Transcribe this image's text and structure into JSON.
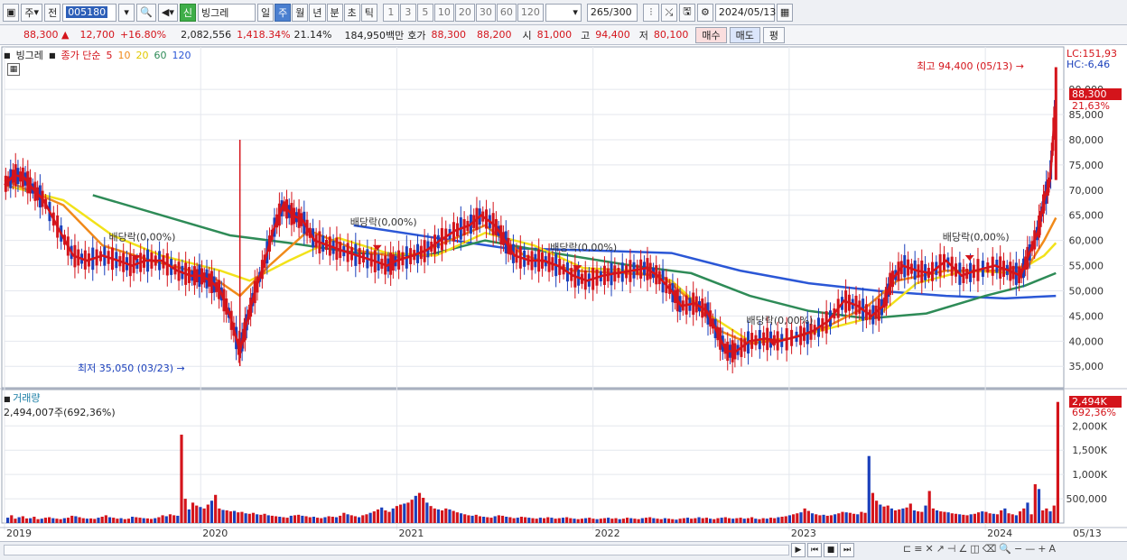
{
  "toolbar": {
    "type_label": "주",
    "prev_label": "전",
    "stock_code": "005180",
    "new_badge": "신",
    "stock_name": "빙그레",
    "periods": [
      "일",
      "주",
      "월",
      "년",
      "분",
      "초",
      "틱"
    ],
    "active_period": "주",
    "intervals": [
      "1",
      "3",
      "5",
      "10",
      "20",
      "30",
      "60",
      "120"
    ],
    "count": "265",
    "count_total": "/300",
    "date": "2024/05/13"
  },
  "infobar": {
    "price": "88,300 ▲",
    "change": "12,700",
    "change_pct": "+16.80%",
    "volume": "2,082,556",
    "volume_pct": "1,418.34%",
    "turnover": "21.14%",
    "amount": "184,950백만",
    "quote_label": "호가",
    "ask": "88,300",
    "bid": "88,200",
    "open_label": "시",
    "open": "81,000",
    "high_label": "고",
    "high": "94,400",
    "low_label": "저",
    "low": "80,100",
    "buy_label": "매수",
    "sell_label": "매도",
    "avg_label": "평"
  },
  "legend": {
    "name": "빙그레",
    "price_label": "종가 단순",
    "ma5": "5",
    "ma10": "10",
    "ma20": "20",
    "ma60": "60",
    "ma120": "120",
    "colors": {
      "ma5": "#d4141b",
      "ma10": "#f08a1a",
      "ma20": "#f2e21a",
      "ma60": "#2e8b57",
      "ma120": "#2b57d6"
    }
  },
  "annotations": {
    "lc": "LC:151,93",
    "hc": "HC:-6,46",
    "high_marker": "최고 94,400 (05/13)",
    "low_marker": "최저 35,050 (03/23)",
    "current_price": "88,300",
    "current_pct": "21,63%",
    "dividend": "배당락(0,00%)",
    "vol_current": "2,494K",
    "vol_pct": "692,36%"
  },
  "volume_panel": {
    "title": "거래량",
    "info": "2,494,007주(692,36%)"
  },
  "chart_data": {
    "type": "candlestick",
    "price_axis": [
      "90,000",
      "85,000",
      "80,000",
      "75,000",
      "70,000",
      "65,000",
      "60,000",
      "55,000",
      "50,000",
      "45,000",
      "40,000",
      "35,000"
    ],
    "price_range": [
      32000,
      97000
    ],
    "volume_axis": [
      "2,000K",
      "1,500K",
      "1,000K",
      "500,000"
    ],
    "volume_range": [
      0,
      2600
    ],
    "x_labels": [
      "2019",
      "2020",
      "2021",
      "2022",
      "2023",
      "2024"
    ],
    "end_label": "05/13",
    "close_path": [
      [
        2019.0,
        71000
      ],
      [
        2019.05,
        73000
      ],
      [
        2019.1,
        72500
      ],
      [
        2019.15,
        70000
      ],
      [
        2019.2,
        68000
      ],
      [
        2019.28,
        62000
      ],
      [
        2019.35,
        57000
      ],
      [
        2019.42,
        56000
      ],
      [
        2019.5,
        57000
      ],
      [
        2019.58,
        56000
      ],
      [
        2019.65,
        55000
      ],
      [
        2019.72,
        56000
      ],
      [
        2019.8,
        56000
      ],
      [
        2019.88,
        54000
      ],
      [
        2019.95,
        53000
      ],
      [
        2020.0,
        53000
      ],
      [
        2020.05,
        52000
      ],
      [
        2020.1,
        50000
      ],
      [
        2020.15,
        45000
      ],
      [
        2020.2,
        38000
      ],
      [
        2020.23,
        43000
      ],
      [
        2020.27,
        49000
      ],
      [
        2020.32,
        55000
      ],
      [
        2020.37,
        62000
      ],
      [
        2020.42,
        67000
      ],
      [
        2020.47,
        65000
      ],
      [
        2020.52,
        64000
      ],
      [
        2020.58,
        60000
      ],
      [
        2020.65,
        59000
      ],
      [
        2020.72,
        58000
      ],
      [
        2020.8,
        57000
      ],
      [
        2020.88,
        56000
      ],
      [
        2020.95,
        55000
      ],
      [
        2021.0,
        56000
      ],
      [
        2021.08,
        57000
      ],
      [
        2021.15,
        58000
      ],
      [
        2021.22,
        60000
      ],
      [
        2021.3,
        62000
      ],
      [
        2021.37,
        63000
      ],
      [
        2021.43,
        65000
      ],
      [
        2021.5,
        63000
      ],
      [
        2021.55,
        60000
      ],
      [
        2021.6,
        57000
      ],
      [
        2021.68,
        56000
      ],
      [
        2021.75,
        56000
      ],
      [
        2021.82,
        55000
      ],
      [
        2021.9,
        53000
      ],
      [
        2021.97,
        52000
      ],
      [
        2022.05,
        53000
      ],
      [
        2022.12,
        53500
      ],
      [
        2022.2,
        54000
      ],
      [
        2022.27,
        54500
      ],
      [
        2022.33,
        53000
      ],
      [
        2022.4,
        50000
      ],
      [
        2022.45,
        47000
      ],
      [
        2022.52,
        47500
      ],
      [
        2022.58,
        46000
      ],
      [
        2022.63,
        42000
      ],
      [
        2022.68,
        38000
      ],
      [
        2022.73,
        38000
      ],
      [
        2022.8,
        40000
      ],
      [
        2022.88,
        40500
      ],
      [
        2022.95,
        40000
      ],
      [
        2023.05,
        41000
      ],
      [
        2023.12,
        42000
      ],
      [
        2023.2,
        44000
      ],
      [
        2023.28,
        48000
      ],
      [
        2023.35,
        47000
      ],
      [
        2023.42,
        45000
      ],
      [
        2023.48,
        47000
      ],
      [
        2023.52,
        52000
      ],
      [
        2023.58,
        55000
      ],
      [
        2023.65,
        54000
      ],
      [
        2023.72,
        53500
      ],
      [
        2023.8,
        56000
      ],
      [
        2023.88,
        53000
      ],
      [
        2023.95,
        54000
      ],
      [
        2024.05,
        55000
      ],
      [
        2024.12,
        54000
      ],
      [
        2024.18,
        53000
      ],
      [
        2024.22,
        57000
      ],
      [
        2024.27,
        62000
      ],
      [
        2024.3,
        68000
      ],
      [
        2024.33,
        72000
      ],
      [
        2024.36,
        88300
      ]
    ],
    "ma_series": [
      {
        "key": "ma120",
        "points": [
          [
            2020.78,
            63000
          ],
          [
            2021.2,
            60500
          ],
          [
            2021.55,
            58500
          ],
          [
            2022.0,
            58000
          ],
          [
            2022.4,
            57500
          ],
          [
            2022.75,
            54000
          ],
          [
            2023.1,
            51500
          ],
          [
            2023.45,
            50000
          ],
          [
            2023.8,
            49000
          ],
          [
            2024.1,
            48500
          ],
          [
            2024.36,
            49000
          ]
        ]
      },
      {
        "key": "ma60",
        "points": [
          [
            2019.45,
            69000
          ],
          [
            2019.8,
            65000
          ],
          [
            2020.15,
            61000
          ],
          [
            2020.45,
            59500
          ],
          [
            2020.8,
            57500
          ],
          [
            2021.15,
            57000
          ],
          [
            2021.45,
            60000
          ],
          [
            2021.8,
            57500
          ],
          [
            2022.2,
            55000
          ],
          [
            2022.5,
            53500
          ],
          [
            2022.8,
            49000
          ],
          [
            2023.1,
            46000
          ],
          [
            2023.4,
            44500
          ],
          [
            2023.7,
            45500
          ],
          [
            2024.0,
            49000
          ],
          [
            2024.2,
            51000
          ],
          [
            2024.36,
            53500
          ]
        ]
      },
      {
        "key": "ma20",
        "points": [
          [
            2019.0,
            71000
          ],
          [
            2019.3,
            68000
          ],
          [
            2019.55,
            61000
          ],
          [
            2019.8,
            57000
          ],
          [
            2020.1,
            54000
          ],
          [
            2020.25,
            52000
          ],
          [
            2020.45,
            56000
          ],
          [
            2020.7,
            60500
          ],
          [
            2020.95,
            57500
          ],
          [
            2021.2,
            57000
          ],
          [
            2021.45,
            61500
          ],
          [
            2021.7,
            59000
          ],
          [
            2021.95,
            54500
          ],
          [
            2022.2,
            54000
          ],
          [
            2022.4,
            52000
          ],
          [
            2022.6,
            45000
          ],
          [
            2022.8,
            40000
          ],
          [
            2023.0,
            40500
          ],
          [
            2023.25,
            43000
          ],
          [
            2023.45,
            45000
          ],
          [
            2023.65,
            51500
          ],
          [
            2023.9,
            54000
          ],
          [
            2024.15,
            53500
          ],
          [
            2024.3,
            57000
          ],
          [
            2024.36,
            59500
          ]
        ]
      },
      {
        "key": "ma10",
        "points": [
          [
            2019.0,
            72000
          ],
          [
            2019.3,
            67000
          ],
          [
            2019.5,
            59000
          ],
          [
            2019.75,
            56000
          ],
          [
            2020.05,
            53000
          ],
          [
            2020.2,
            49000
          ],
          [
            2020.35,
            55000
          ],
          [
            2020.55,
            62000
          ],
          [
            2020.8,
            58000
          ],
          [
            2021.05,
            56500
          ],
          [
            2021.3,
            60500
          ],
          [
            2021.45,
            63000
          ],
          [
            2021.65,
            57000
          ],
          [
            2021.9,
            54000
          ],
          [
            2022.15,
            53500
          ],
          [
            2022.35,
            53000
          ],
          [
            2022.5,
            48000
          ],
          [
            2022.65,
            42000
          ],
          [
            2022.8,
            39500
          ],
          [
            2023.0,
            40500
          ],
          [
            2023.2,
            43000
          ],
          [
            2023.4,
            47000
          ],
          [
            2023.55,
            52000
          ],
          [
            2023.8,
            54000
          ],
          [
            2024.05,
            54000
          ],
          [
            2024.22,
            55000
          ],
          [
            2024.3,
            60000
          ],
          [
            2024.36,
            64500
          ]
        ]
      }
    ],
    "dividend_marks": [
      [
        2019.67,
        56000
      ],
      [
        2020.9,
        58000
      ],
      [
        2021.92,
        54000
      ],
      [
        2022.92,
        39000
      ],
      [
        2023.92,
        56000
      ]
    ],
    "dividend_label_positions": [
      [
        2019.67,
        60000
      ],
      [
        2020.9,
        63000
      ],
      [
        2021.92,
        58000
      ],
      [
        2022.92,
        43500
      ],
      [
        2023.92,
        60000
      ]
    ],
    "volume_bars_k": [
      110,
      160,
      90,
      120,
      140,
      95,
      100,
      130,
      80,
      90,
      110,
      120,
      100,
      90,
      80,
      100,
      110,
      150,
      140,
      120,
      100,
      90,
      95,
      85,
      110,
      130,
      160,
      120,
      110,
      90,
      100,
      80,
      90,
      130,
      120,
      110,
      100,
      95,
      85,
      100,
      120,
      160,
      140,
      180,
      160,
      150,
      1820,
      500,
      280,
      420,
      360,
      330,
      300,
      380,
      460,
      580,
      300,
      270,
      260,
      240,
      250,
      220,
      230,
      200,
      190,
      210,
      180,
      170,
      190,
      160,
      150,
      140,
      130,
      120,
      110,
      150,
      160,
      170,
      150,
      140,
      120,
      130,
      110,
      100,
      120,
      140,
      130,
      120,
      150,
      210,
      180,
      160,
      140,
      120,
      160,
      180,
      210,
      240,
      280,
      320,
      260,
      230,
      300,
      350,
      380,
      400,
      420,
      480,
      560,
      620,
      520,
      420,
      350,
      300,
      280,
      260,
      300,
      280,
      250,
      220,
      200,
      180,
      160,
      150,
      170,
      140,
      130,
      120,
      110,
      140,
      160,
      150,
      130,
      120,
      100,
      110,
      130,
      120,
      110,
      100,
      90,
      110,
      100,
      120,
      110,
      90,
      100,
      110,
      120,
      100,
      90,
      80,
      90,
      100,
      110,
      90,
      80,
      90,
      100,
      110,
      90,
      100,
      80,
      90,
      110,
      100,
      90,
      80,
      100,
      110,
      120,
      100,
      90,
      80,
      100,
      90,
      80,
      70,
      90,
      100,
      110,
      90,
      100,
      120,
      100,
      110,
      90,
      80,
      100,
      110,
      120,
      100,
      90,
      100,
      110,
      90,
      100,
      120,
      90,
      80,
      100,
      90,
      110,
      100,
      120,
      130,
      140,
      160,
      180,
      200,
      220,
      300,
      250,
      200,
      180,
      160,
      170,
      150,
      160,
      180,
      200,
      230,
      220,
      210,
      190,
      180,
      230,
      210,
      1380,
      620,
      460,
      380,
      340,
      360,
      300,
      260,
      280,
      300,
      320,
      400,
      260,
      240,
      230,
      360,
      660,
      300,
      260,
      240,
      230,
      220,
      200,
      190,
      180,
      170,
      160,
      180,
      190,
      220,
      240,
      230,
      200,
      190,
      180,
      260,
      300,
      200,
      180,
      160,
      240,
      300,
      420,
      180,
      800,
      700,
      260,
      300,
      240,
      360,
      2494
    ]
  }
}
